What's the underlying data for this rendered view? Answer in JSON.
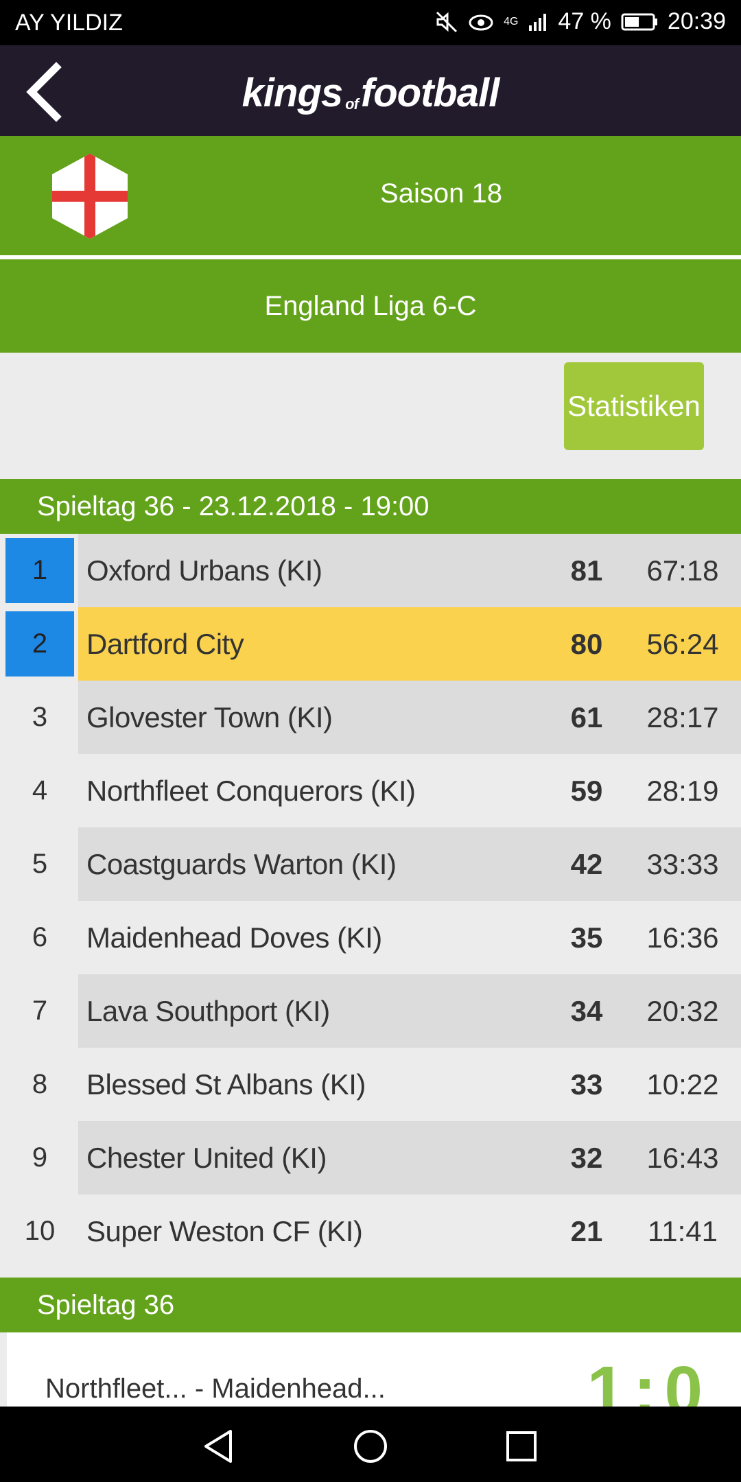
{
  "status_bar": {
    "carrier": "AY YILDIZ",
    "network": "4G",
    "battery": "47 %",
    "time": "20:39"
  },
  "header": {
    "logo_kings": "kings",
    "logo_of": "of",
    "logo_football": "football"
  },
  "season": {
    "label": "Saison 18",
    "flag": "england-flag"
  },
  "league": {
    "name": "England Liga 6-C"
  },
  "stats_button": "Statistiken",
  "matchday": {
    "title": "Spieltag 36 - 23.12.2018 - 19:00"
  },
  "standings": [
    {
      "rank": "1",
      "team": "Oxford Urbans (KI)",
      "points": "81",
      "goals": "67:18"
    },
    {
      "rank": "2",
      "team": "Dartford City",
      "points": "80",
      "goals": "56:24"
    },
    {
      "rank": "3",
      "team": "Glovester Town (KI)",
      "points": "61",
      "goals": "28:17"
    },
    {
      "rank": "4",
      "team": "Northfleet Conquerors (KI)",
      "points": "59",
      "goals": "28:19"
    },
    {
      "rank": "5",
      "team": "Coastguards Warton (KI)",
      "points": "42",
      "goals": "33:33"
    },
    {
      "rank": "6",
      "team": "Maidenhead Doves (KI)",
      "points": "35",
      "goals": "16:36"
    },
    {
      "rank": "7",
      "team": "Lava Southport (KI)",
      "points": "34",
      "goals": "20:32"
    },
    {
      "rank": "8",
      "team": "Blessed St Albans (KI)",
      "points": "33",
      "goals": "10:22"
    },
    {
      "rank": "9",
      "team": "Chester United (KI)",
      "points": "32",
      "goals": "16:43"
    },
    {
      "rank": "10",
      "team": "Super Weston CF (KI)",
      "points": "21",
      "goals": "11:41"
    }
  ],
  "matches": {
    "title": "Spieltag 36",
    "items": [
      {
        "teams": "Northfleet... - Maidenhead...",
        "score": "1:0"
      }
    ]
  },
  "colors": {
    "green": "#63a31b",
    "header": "#221b2b",
    "promo": "#1e88e5",
    "highlight": "#fbd24e",
    "stats_button": "#a1c83a"
  }
}
